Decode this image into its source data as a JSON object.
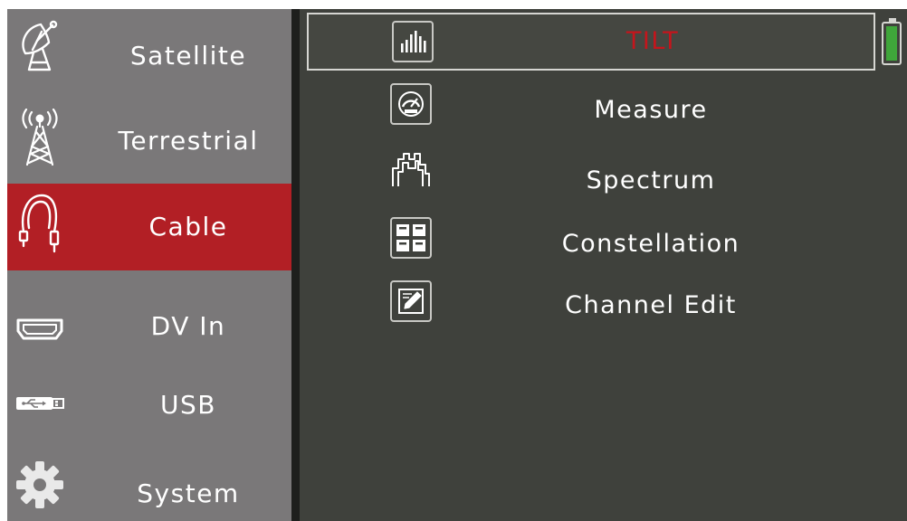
{
  "sidebar": {
    "items": [
      {
        "label": "Satellite",
        "icon": "satellite-dish-icon",
        "active": false
      },
      {
        "label": "Terrestrial",
        "icon": "antenna-tower-icon",
        "active": false
      },
      {
        "label": "Cable",
        "icon": "cable-icon",
        "active": true
      },
      {
        "label": "DV In",
        "icon": "hdmi-port-icon",
        "active": false
      },
      {
        "label": "USB",
        "icon": "usb-stick-icon",
        "active": false
      },
      {
        "label": "System",
        "icon": "gear-icon",
        "active": false
      }
    ]
  },
  "menu": {
    "items": [
      {
        "label": "TILT",
        "icon": "tilt-bars-icon",
        "selected": true
      },
      {
        "label": "Measure",
        "icon": "meter-gauge-icon",
        "selected": false
      },
      {
        "label": "Spectrum",
        "icon": "spectrum-icon",
        "selected": false
      },
      {
        "label": "Constellation",
        "icon": "constellation-icon",
        "selected": false
      },
      {
        "label": "Channel Edit",
        "icon": "edit-note-icon",
        "selected": false
      }
    ]
  },
  "status": {
    "battery_level_percent": 100,
    "battery_icon": "battery-icon"
  },
  "colors": {
    "sidebar_bg": "#7a7879",
    "active_bg": "#b21f25",
    "main_bg": "#3f413c",
    "selected_text": "#c4151c",
    "text": "#ffffff",
    "battery_fill": "#3fa63a"
  }
}
